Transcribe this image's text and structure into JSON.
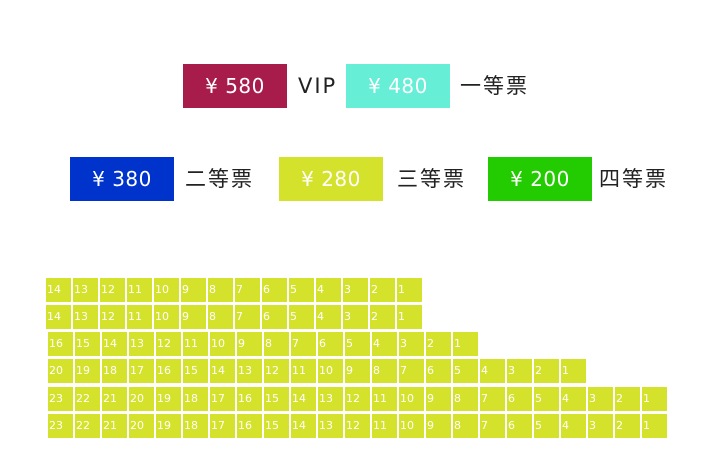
{
  "legend": {
    "tiers": [
      {
        "price": "¥ 580",
        "label": "VIP",
        "color": "#a81c4b"
      },
      {
        "price": "¥ 480",
        "label": "一等票",
        "color": "#66eed6"
      },
      {
        "price": "¥ 380",
        "label": "二等票",
        "color": "#0033cc"
      },
      {
        "price": "¥ 280",
        "label": "三等票",
        "color": "#d4e22b"
      },
      {
        "price": "¥ 200",
        "label": "四等票",
        "color": "#22cc00"
      }
    ]
  },
  "seat_map": {
    "seat_color": "#d4e22b",
    "rows": [
      {
        "seats": [
          "14",
          "13",
          "12",
          "11",
          "10",
          "9",
          "8",
          "7",
          "6",
          "5",
          "4",
          "3",
          "2",
          "1"
        ]
      },
      {
        "seats": [
          "14",
          "13",
          "12",
          "11",
          "10",
          "9",
          "8",
          "7",
          "6",
          "5",
          "4",
          "3",
          "2",
          "1"
        ]
      },
      {
        "seats": [
          "16",
          "15",
          "14",
          "13",
          "12",
          "11",
          "10",
          "9",
          "8",
          "7",
          "6",
          "5",
          "4",
          "3",
          "2",
          "1"
        ]
      },
      {
        "seats": [
          "20",
          "19",
          "18",
          "17",
          "16",
          "15",
          "14",
          "13",
          "12",
          "11",
          "10",
          "9",
          "8",
          "7",
          "6",
          "5",
          "4",
          "3",
          "2",
          "1"
        ]
      },
      {
        "seats": [
          "23",
          "22",
          "21",
          "20",
          "19",
          "18",
          "17",
          "16",
          "15",
          "14",
          "13",
          "12",
          "11",
          "10",
          "9",
          "8",
          "7",
          "6",
          "5",
          "4",
          "3",
          "2",
          "1"
        ]
      },
      {
        "seats": [
          "23",
          "22",
          "21",
          "20",
          "19",
          "18",
          "17",
          "16",
          "15",
          "14",
          "13",
          "12",
          "11",
          "10",
          "9",
          "8",
          "7",
          "6",
          "5",
          "4",
          "3",
          "2",
          "1"
        ]
      }
    ]
  }
}
